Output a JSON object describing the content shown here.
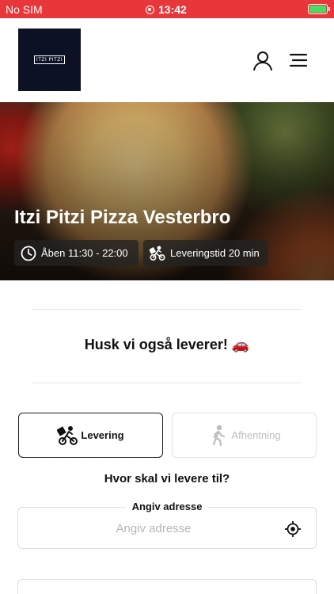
{
  "status_bar": {
    "carrier": "No SIM",
    "time": "13:42"
  },
  "header": {
    "logo_text": "ITZI PITZI",
    "user_icon": "user-icon",
    "menu_icon": "menu-icon"
  },
  "hero": {
    "title": "Itzi Pitzi Pizza Vesterbro",
    "opening_hours": "Åben 11:30 - 22:00",
    "delivery_time": "Leveringstid 20 min"
  },
  "promo": {
    "text": "Husk vi også leverer! 🚗"
  },
  "order_type": {
    "delivery_label": "Levering",
    "pickup_label": "Afhentning",
    "selected": "Levering"
  },
  "address": {
    "question": "Hvor skal vi levere til?",
    "legend": "Angiv adresse",
    "placeholder": "Angiv adresse",
    "value": ""
  },
  "colors": {
    "status_bar": "#e8373a",
    "logo_bg": "#0d1126",
    "battery": "#4cd964"
  }
}
